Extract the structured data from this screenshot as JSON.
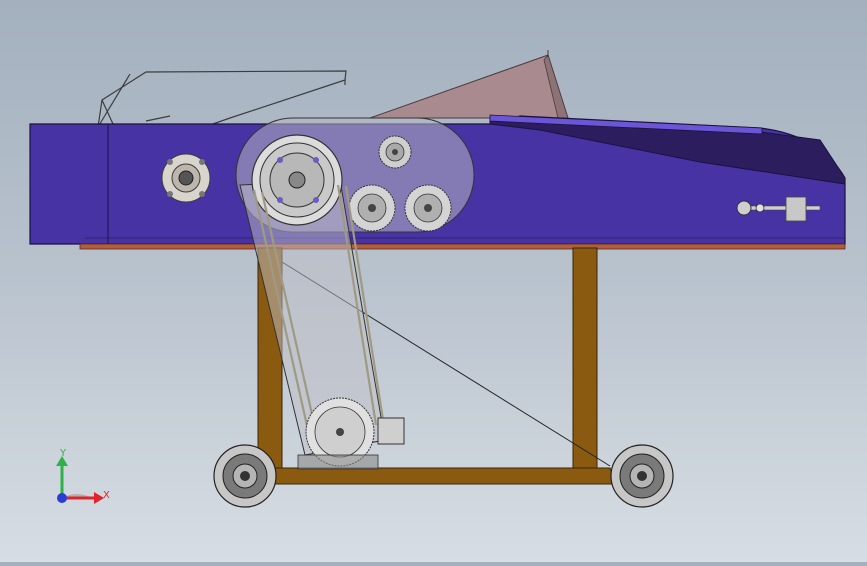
{
  "viewport": {
    "background_top": "#a3b0be",
    "background_bottom": "#d7dde3"
  },
  "model": {
    "body_color": "#4733a3",
    "body_dark": "#2a1c66",
    "frame_color": "#8a5a10",
    "hopper_color": "#a98b8f",
    "wheel_color": "#6f6f6f"
  },
  "triad": {
    "x_label": "X",
    "y_label": "Y",
    "x_color": "#e0242a",
    "y_color": "#2fb14a",
    "z_color": "#2a3cd6"
  }
}
